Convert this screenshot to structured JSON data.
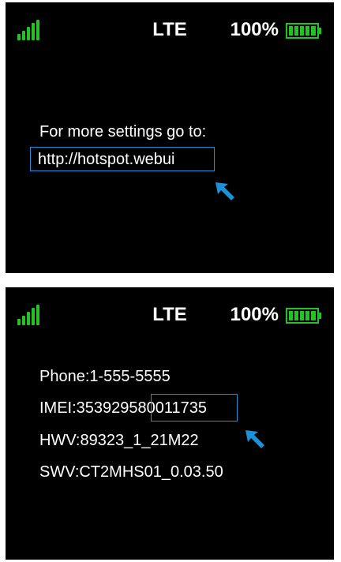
{
  "screens": [
    {
      "status": {
        "network": "LTE",
        "battery_percent": "100%",
        "signal_bars": 5
      },
      "content": {
        "line1": "For more settings go to:",
        "url": "http://hotspot.webui"
      }
    },
    {
      "status": {
        "network": "LTE",
        "battery_percent": "100%",
        "signal_bars": 5
      },
      "content": {
        "phone": "Phone:1-555-5555",
        "imei_prefix": "IMEI:353929",
        "imei_suffix": "580011735",
        "hwv": "HWV:89323_1_21M22",
        "swv": "SWV:CT2MHS01_0.03.50"
      }
    }
  ],
  "colors": {
    "signal": "#22c322",
    "battery": "#22c322",
    "highlight": "#1e90d6",
    "pointer": "#1e90d6"
  },
  "icons": {
    "signal": "signal-strength-icon",
    "battery": "battery-full-icon",
    "pointer": "pointer-arrow-icon"
  }
}
